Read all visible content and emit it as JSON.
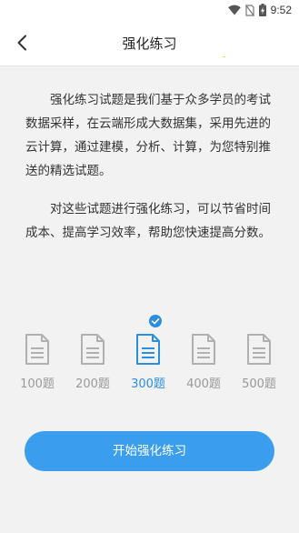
{
  "status_bar": {
    "time": "9:52",
    "icons": [
      "wifi-icon",
      "sim-blocked-icon",
      "battery-charging-icon"
    ]
  },
  "nav": {
    "title": "强化练习",
    "back_icon": "chevron-left-icon"
  },
  "intro": {
    "paragraph1": "强化练习试题是我们基于众多学员的考试数据采样，在云端形成大数据集，采用先进的云计算，通过建模，分析、计算，为您特别推送的精选试题。",
    "paragraph2": "对这些试题进行强化练习，可以节省时间成本、提高学习效率，帮助您快速提高分数。"
  },
  "options": [
    {
      "label": "100题",
      "selected": false
    },
    {
      "label": "200题",
      "selected": false
    },
    {
      "label": "300题",
      "selected": true
    },
    {
      "label": "400题",
      "selected": false
    },
    {
      "label": "500题",
      "selected": false
    }
  ],
  "start_button": {
    "label": "开始强化练习"
  },
  "colors": {
    "accent": "#3a9ded",
    "selected": "#2a8ee0",
    "unselected": "#999999",
    "background": "#f2f2f2"
  }
}
